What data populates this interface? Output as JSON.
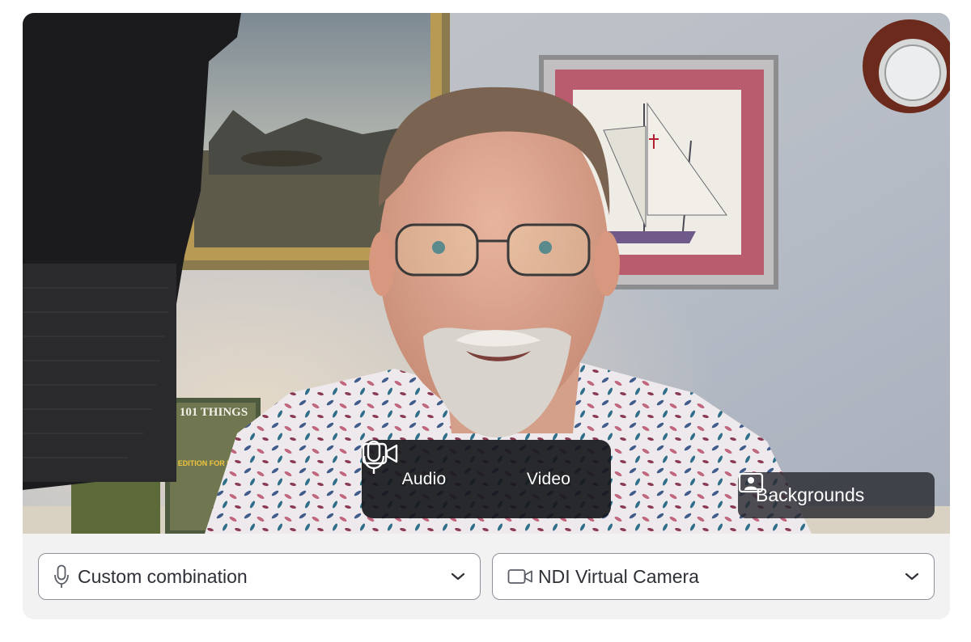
{
  "media_toggle": {
    "audio": {
      "label": "Audio",
      "icon": "microphone-icon"
    },
    "video": {
      "label": "Video",
      "icon": "video-camera-icon"
    }
  },
  "backgrounds_button": {
    "label": "Backgrounds",
    "icon": "person-frame-icon"
  },
  "audio_select": {
    "value": "Custom combination",
    "icon": "microphone-icon"
  },
  "video_select": {
    "value": "NDI Virtual Camera",
    "icon": "video-camera-icon"
  },
  "book_cover": {
    "title": "101 THINGS",
    "subtitle": "SPECIAL EDITION FOR PASTORS ONLY"
  },
  "colors": {
    "overlay": "#16181c",
    "select_border": "#8e9199",
    "card_bg": "#f2f2f3"
  }
}
